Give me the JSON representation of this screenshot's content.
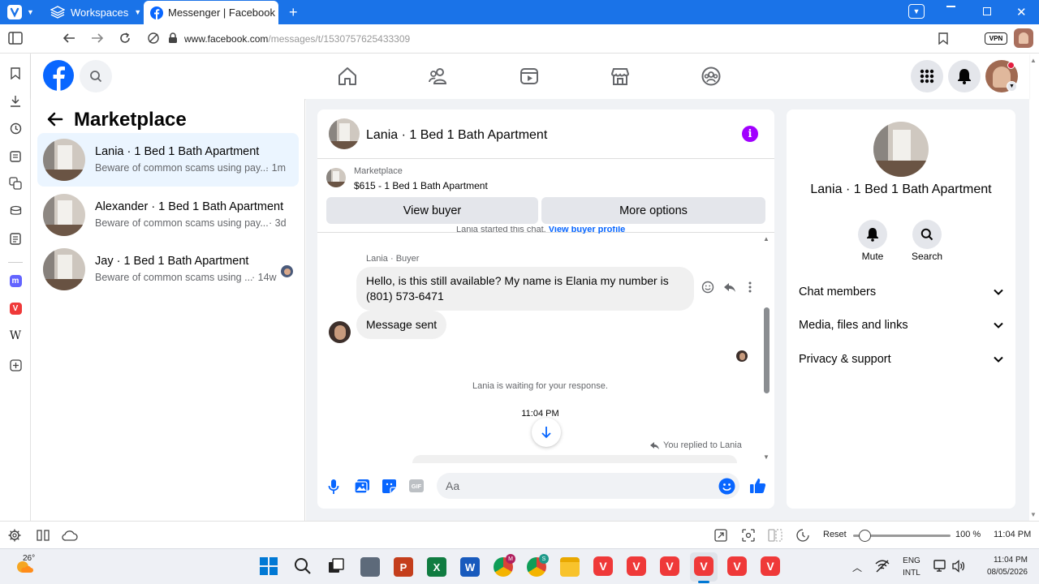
{
  "browser": {
    "workspaces_label": "Workspaces",
    "tab_title": "Messenger | Facebook",
    "url_host": "www.facebook.com",
    "url_path": "/messages/t/1530757625433309",
    "vpn_label": "VPN"
  },
  "marketplace": {
    "title": "Marketplace",
    "chats": [
      {
        "name": "Lania · 1 Bed 1 Bath Apartment",
        "preview": "Beware of common scams using pay...",
        "time": "· 1m"
      },
      {
        "name": "Alexander · 1 Bed 1 Bath Apartment",
        "preview": "Beware of common scams using pay...",
        "time": "· 3d"
      },
      {
        "name": "Jay · 1 Bed 1 Bath Apartment",
        "preview": "Beware of common scams using ...",
        "time": "· 14w"
      }
    ]
  },
  "conversation": {
    "title": "Lania · 1 Bed 1 Bath Apartment",
    "listing_source": "Marketplace",
    "listing_price_title": "$615 - 1 Bed 1 Bath Apartment",
    "view_buyer": "View buyer",
    "more_options": "More options",
    "started_text": "Lania started this chat.",
    "view_buyer_profile": "View buyer profile",
    "sender_label": "Lania · Buyer",
    "message_in": "Hello, is this still available? My name is Elania my number is (801) 573-6471",
    "message_out": "Message sent",
    "waiting_text": "Lania is waiting for your response.",
    "timestamp": "11:04 PM",
    "replied_text": "You replied to Lania",
    "composer_placeholder": "Aa"
  },
  "details": {
    "title": "Lania · 1 Bed 1 Bath Apartment",
    "mute_label": "Mute",
    "search_label": "Search",
    "sections": [
      "Chat members",
      "Media, files and links",
      "Privacy & support"
    ]
  },
  "statusbar": {
    "reset_label": "Reset",
    "zoom": "100 %",
    "zoom_fraction": 0.12,
    "clock": "11:04 PM"
  },
  "taskbar": {
    "temperature": "26°",
    "lang_1": "ENG",
    "lang_2": "INTL",
    "time": "11:04 PM",
    "date": "08/05/2026"
  },
  "colors": {
    "browser_blue": "#1a73e8",
    "facebook_blue": "#0866ff",
    "info_purple": "#a100ff",
    "vivaldi_red": "#ef3939"
  }
}
